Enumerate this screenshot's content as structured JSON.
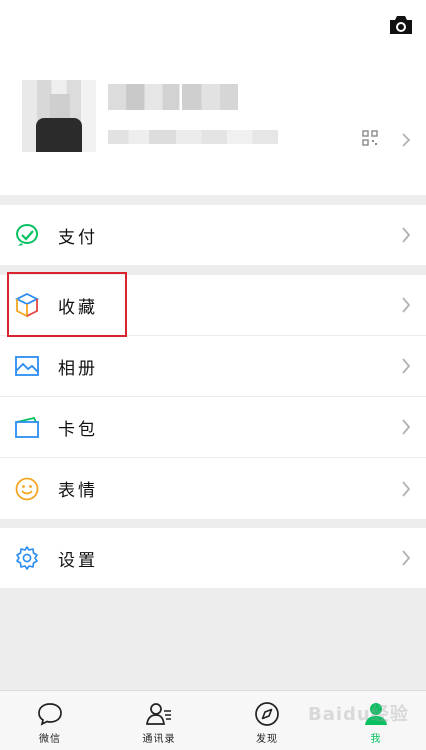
{
  "colors": {
    "accent_green": "#07c160",
    "highlight_red": "#d9232d",
    "icon_blue": "#2a8cf0"
  },
  "profile": {
    "camera_icon": "camera-icon",
    "qr_icon": "qr-code-icon",
    "chevron_icon": "chevron-right-icon"
  },
  "menu": {
    "pay": {
      "label": "支付",
      "icon": "pay-icon"
    },
    "favorites": {
      "label": "收藏",
      "icon": "favorites-cube-icon"
    },
    "album": {
      "label": "相册",
      "icon": "album-image-icon"
    },
    "cards": {
      "label": "卡包",
      "icon": "card-wallet-icon"
    },
    "stickers": {
      "label": "表情",
      "icon": "emoji-smile-icon"
    },
    "settings": {
      "label": "设置",
      "icon": "settings-gear-icon"
    }
  },
  "tabbar": {
    "chats": {
      "label": "微信",
      "icon": "chat-bubble-icon"
    },
    "contacts": {
      "label": "通讯录",
      "icon": "contacts-icon"
    },
    "discover": {
      "label": "发现",
      "icon": "compass-icon"
    },
    "me": {
      "label": "我",
      "icon": "person-icon",
      "active": true
    }
  },
  "watermark": "Baidu经验"
}
